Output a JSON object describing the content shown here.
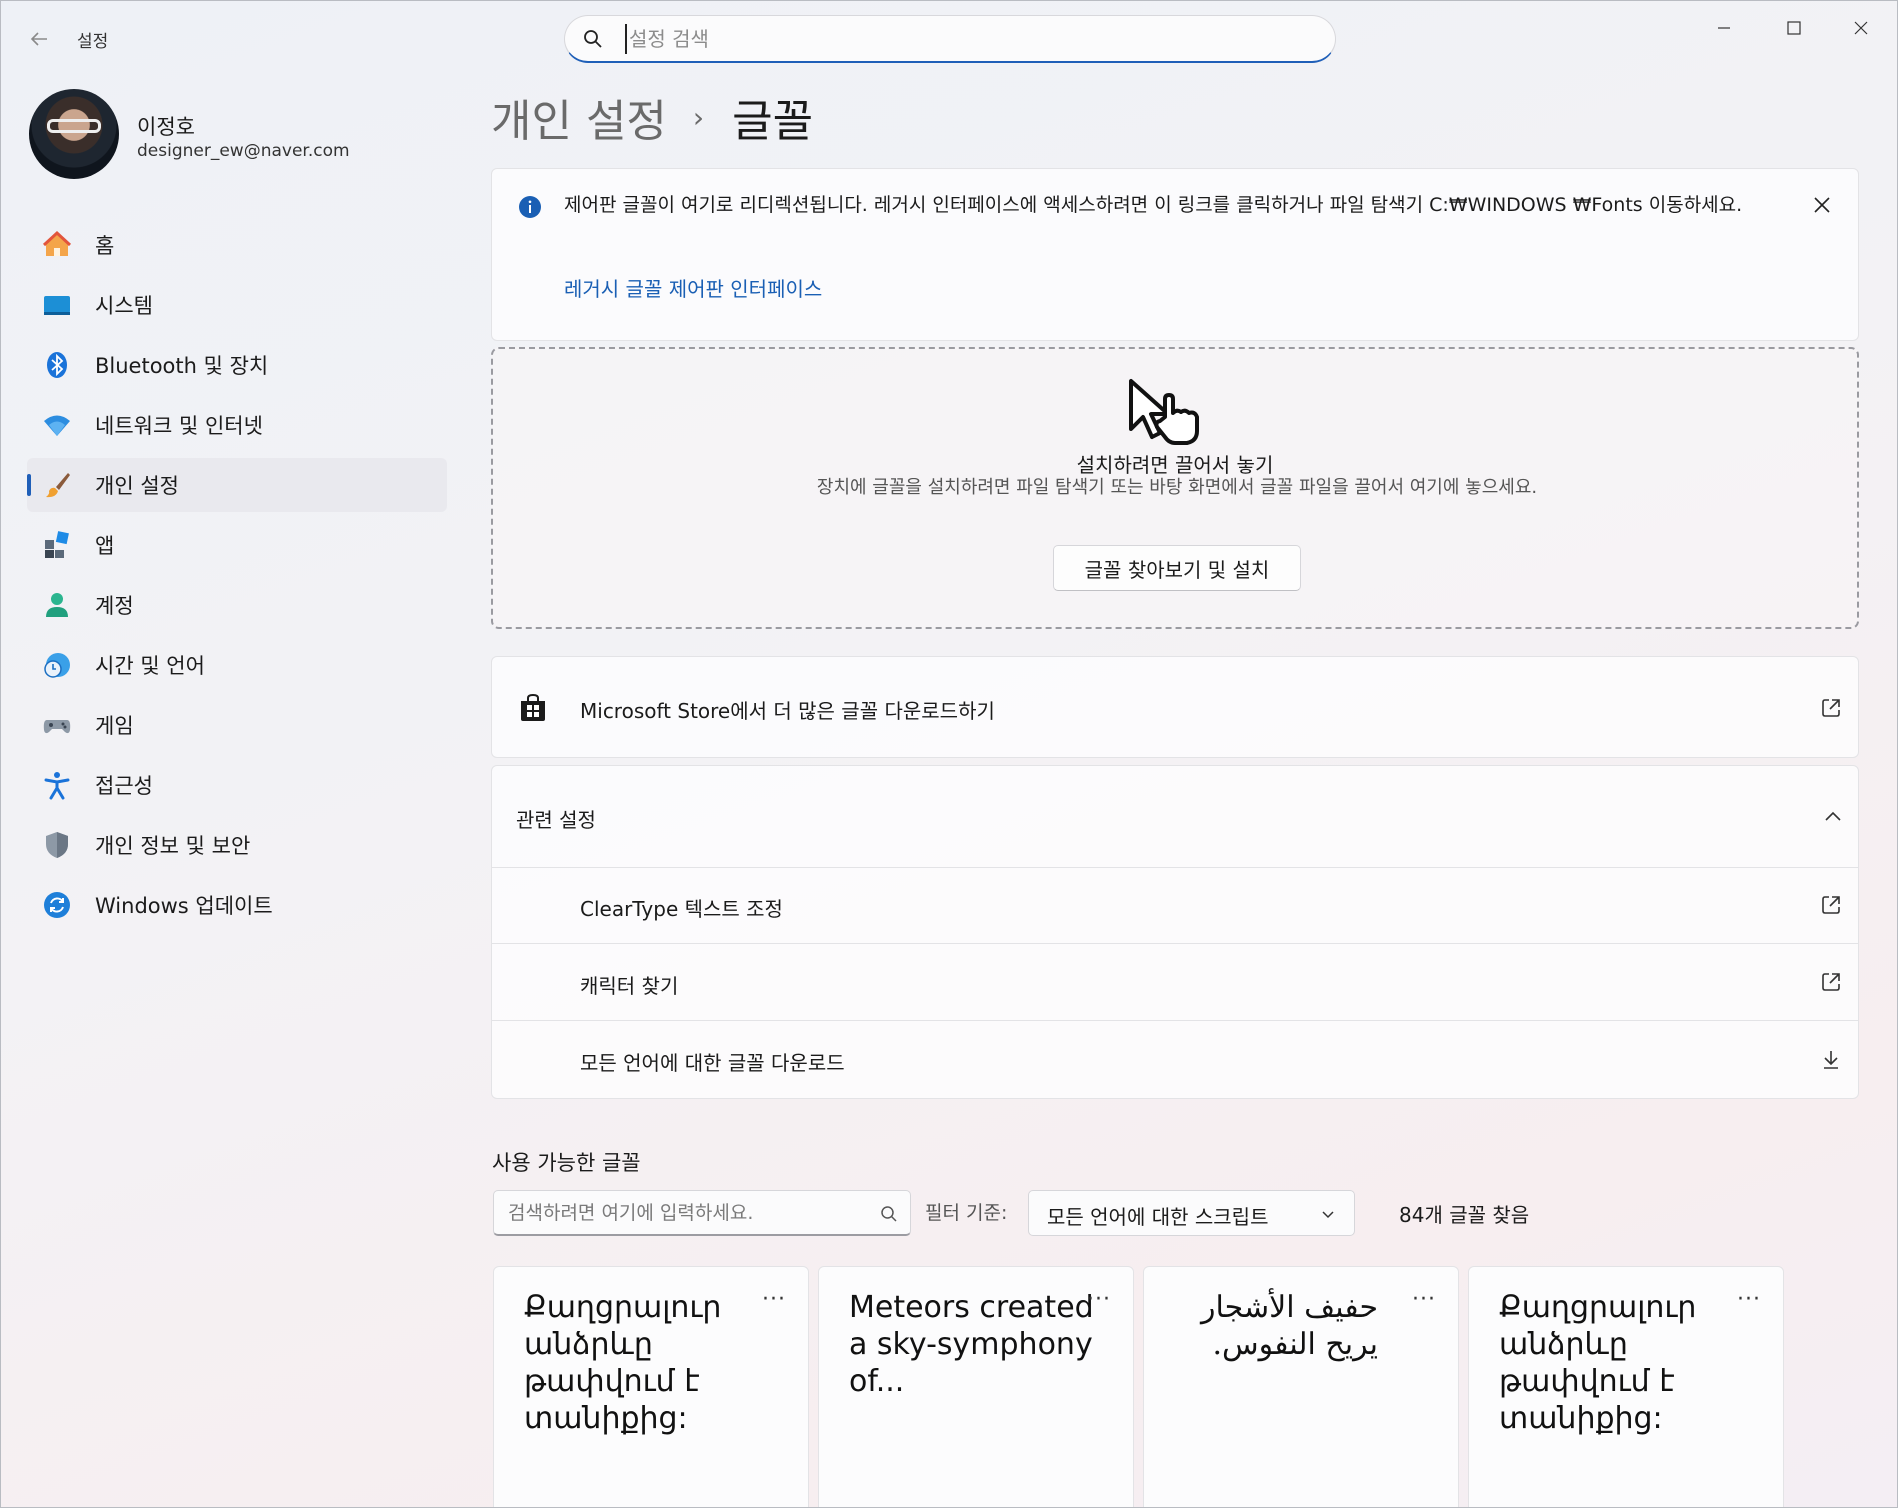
{
  "window": {
    "title": "설정"
  },
  "search": {
    "placeholder": "설정 검색"
  },
  "profile": {
    "name": "이정호",
    "email": "designer_ew@naver.com"
  },
  "sidebar": {
    "items": [
      {
        "label": "홈",
        "icon": "home-icon"
      },
      {
        "label": "시스템",
        "icon": "system-icon"
      },
      {
        "label": "Bluetooth 및 장치",
        "icon": "bluetooth-icon"
      },
      {
        "label": "네트워크 및 인터넷",
        "icon": "wifi-icon"
      },
      {
        "label": "개인 설정",
        "icon": "brush-icon",
        "active": true
      },
      {
        "label": "앱",
        "icon": "apps-icon"
      },
      {
        "label": "계정",
        "icon": "account-icon"
      },
      {
        "label": "시간 및 언어",
        "icon": "clock-globe-icon"
      },
      {
        "label": "게임",
        "icon": "gamepad-icon"
      },
      {
        "label": "접근성",
        "icon": "accessibility-icon"
      },
      {
        "label": "개인 정보 및 보안",
        "icon": "shield-icon"
      },
      {
        "label": "Windows 업데이트",
        "icon": "update-icon"
      }
    ]
  },
  "breadcrumb": {
    "parent": "개인 설정",
    "separator": "›",
    "current": "글꼴"
  },
  "infobar": {
    "message": "제어판 글꼴이 여기로 리디렉션됩니다. 레거시 인터페이스에 액세스하려면 이 링크를 클릭하거나 파일 탐색기 C:₩WINDOWS ₩Fonts 이동하세요.",
    "link": "레거시 글꼴 제어판 인터페이스"
  },
  "dropzone": {
    "title": "설치하려면 끌어서 놓기",
    "description": "장치에 글꼴을 설치하려면 파일 탐색기 또는 바탕 화면에서 글꼴 파일을 끌어서 여기에 놓으세요.",
    "button": "글꼴 찾아보기 및 설치"
  },
  "store": {
    "label": "Microsoft Store에서 더 많은 글꼴 다운로드하기"
  },
  "related": {
    "header": "관련 설정",
    "rows": [
      {
        "label": "ClearType 텍스트 조정",
        "icon": "external-link-icon"
      },
      {
        "label": "캐릭터 찾기",
        "icon": "external-link-icon"
      },
      {
        "label": "모든 언어에 대한 글꼴 다운로드",
        "icon": "download-icon"
      }
    ]
  },
  "available": {
    "title": "사용 가능한 글꼴",
    "search_placeholder": "검색하려면 여기에 입력하세요.",
    "filter_label": "필터 기준:",
    "filter_value": "모든 언어에 대한 스크립트",
    "count": "84개 글꼴 찾음",
    "cards": [
      {
        "sample": "Քաղցրալուր անձրևը թափվում է տանիքից:",
        "more": "···"
      },
      {
        "sample": "Meteors created a sky-symphony of...",
        "more": "···"
      },
      {
        "sample": "حفيف الأشجار يريح النفوس.",
        "more": "···",
        "rtl": true
      },
      {
        "sample": "Քաղցրալուր անձրևը թափվում է տանիքից:",
        "more": "···"
      }
    ]
  },
  "colors": {
    "accent": "#1f5fb8",
    "link": "#1a5fb4"
  }
}
